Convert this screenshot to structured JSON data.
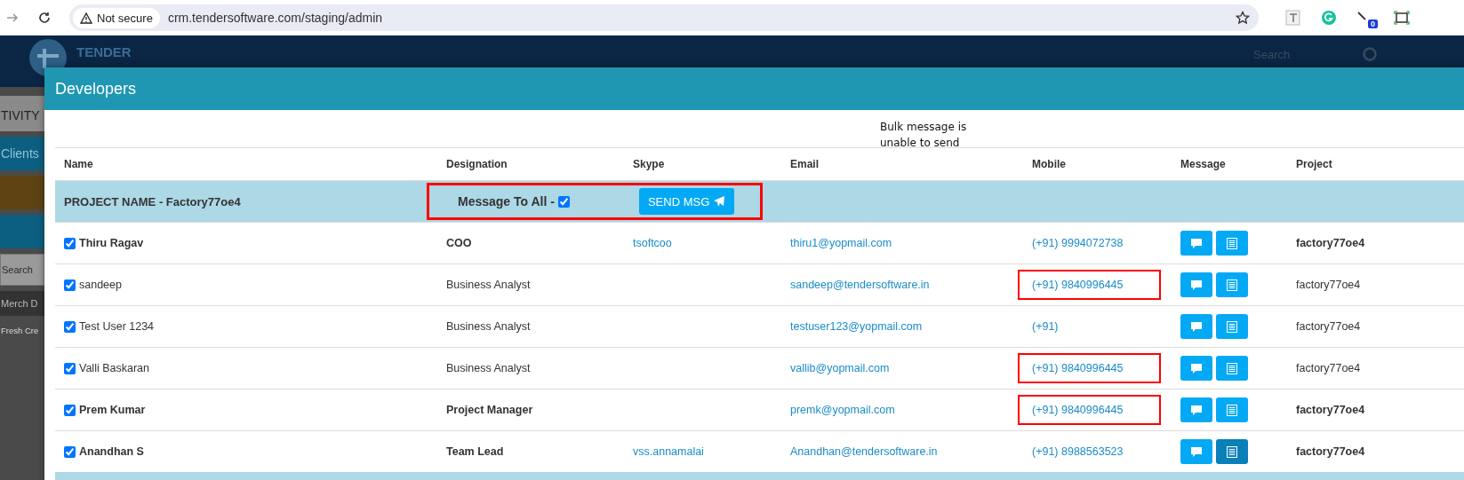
{
  "browser": {
    "security_label": "Not secure",
    "url": "crm.tendersoftware.com/staging/admin",
    "extension_badge": "0"
  },
  "background": {
    "logo_text": "TENDER",
    "search_placeholder": "Search",
    "sidebar": [
      {
        "kind": "heading",
        "label": "TIVITY"
      },
      {
        "kind": "nav",
        "label": "Clients"
      },
      {
        "kind": "tile",
        "color": "#5e4312"
      },
      {
        "kind": "tile",
        "color": "#0c5f80"
      },
      {
        "kind": "search",
        "placeholder": "Search"
      },
      {
        "kind": "section",
        "label": "Merch D"
      },
      {
        "kind": "item",
        "label": "Fresh Cre"
      }
    ]
  },
  "modal": {
    "title": "Developers",
    "note": "Bulk message is unable to send",
    "columns": [
      "Name",
      "Designation",
      "Skype",
      "Email",
      "Mobile",
      "Message",
      "Project"
    ],
    "project_row": {
      "title": "PROJECT NAME - Factory77oe4",
      "message_all_label": "Message To All -",
      "message_all_checked": true,
      "send_label": "SEND MSG",
      "highlighted": true
    },
    "rows": [
      {
        "checked": true,
        "bold": true,
        "name": "Thiru Ragav",
        "designation": "COO",
        "skype": "tsoftcoo",
        "email": "thiru1@yopmail.com",
        "mobile": "(+91) 9994072738",
        "mobile_highlighted": false,
        "list_active": false,
        "project": "factory77oe4"
      },
      {
        "checked": true,
        "bold": false,
        "name": "sandeep",
        "designation": "Business Analyst",
        "email": "sandeep@tendersoftware.in",
        "mobile": "(+91) 9840996445",
        "mobile_highlighted": true,
        "list_active": false,
        "project": "factory77oe4"
      },
      {
        "checked": true,
        "bold": false,
        "name": "Test User 1234",
        "designation": "Business Analyst",
        "email": "testuser123@yopmail.com",
        "mobile": "(+91)",
        "mobile_highlighted": false,
        "list_active": false,
        "project": "factory77oe4"
      },
      {
        "checked": true,
        "bold": false,
        "name": "Valli Baskaran",
        "designation": "Business Analyst",
        "email": "vallib@yopmail.com",
        "mobile": "(+91) 9840996445",
        "mobile_highlighted": true,
        "list_active": false,
        "project": "factory77oe4"
      },
      {
        "checked": true,
        "bold": true,
        "name": "Prem Kumar",
        "designation": "Project Manager",
        "email": "premk@yopmail.com",
        "mobile": "(+91) 9840996445",
        "mobile_highlighted": true,
        "list_active": false,
        "project": "factory77oe4"
      },
      {
        "checked": true,
        "bold": true,
        "name": "Anandhan S",
        "designation": "Team Lead",
        "skype": "vss.annamalai",
        "email": "Anandhan@tendersoftware.in",
        "mobile": "(+91) 8988563523",
        "mobile_highlighted": false,
        "list_active": true,
        "project": "factory77oe4"
      }
    ]
  }
}
